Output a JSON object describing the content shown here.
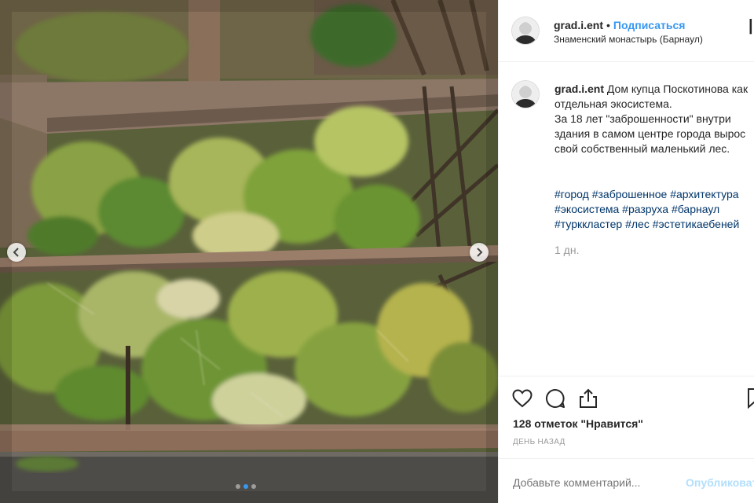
{
  "post": {
    "username": "grad.i.ent",
    "separator": "•",
    "follow_label": "Подписаться",
    "location": "Знаменский монастырь (Барнаул)",
    "more_label": "|"
  },
  "caption": {
    "author": "grad.i.ent",
    "text": "Дом купца Поскотинова как отдельная экосистема.\nЗа 18 лет \"заброшенности\" внутри здания в самом центре города вырос свой собственный маленький лес.",
    "hashtags": [
      "#город",
      "#заброшенное",
      "#архитектура",
      "#экосистема",
      "#разруха",
      "#барнаул",
      "#турккластер",
      "#лес",
      "#эстетикаебеней"
    ],
    "time_ago": "1 дн."
  },
  "engagement": {
    "likes_label": "128 отметок \"Нравится\"",
    "date_label": "ДЕНЬ НАЗАД"
  },
  "comment": {
    "placeholder": "Добавьте комментарий...",
    "publish_label": "Опубликовать"
  },
  "carousel": {
    "slide_count": 3,
    "active_index": 1
  },
  "icons": {
    "like": "heart-icon",
    "comment": "comment-icon",
    "share": "share-icon",
    "save": "bookmark-icon",
    "prev": "chevron-left-icon",
    "next": "chevron-right-icon"
  },
  "colors": {
    "link": "#3897f0",
    "hashtag": "#003569",
    "muted": "#999999",
    "publish_disabled": "#b2dffc"
  }
}
